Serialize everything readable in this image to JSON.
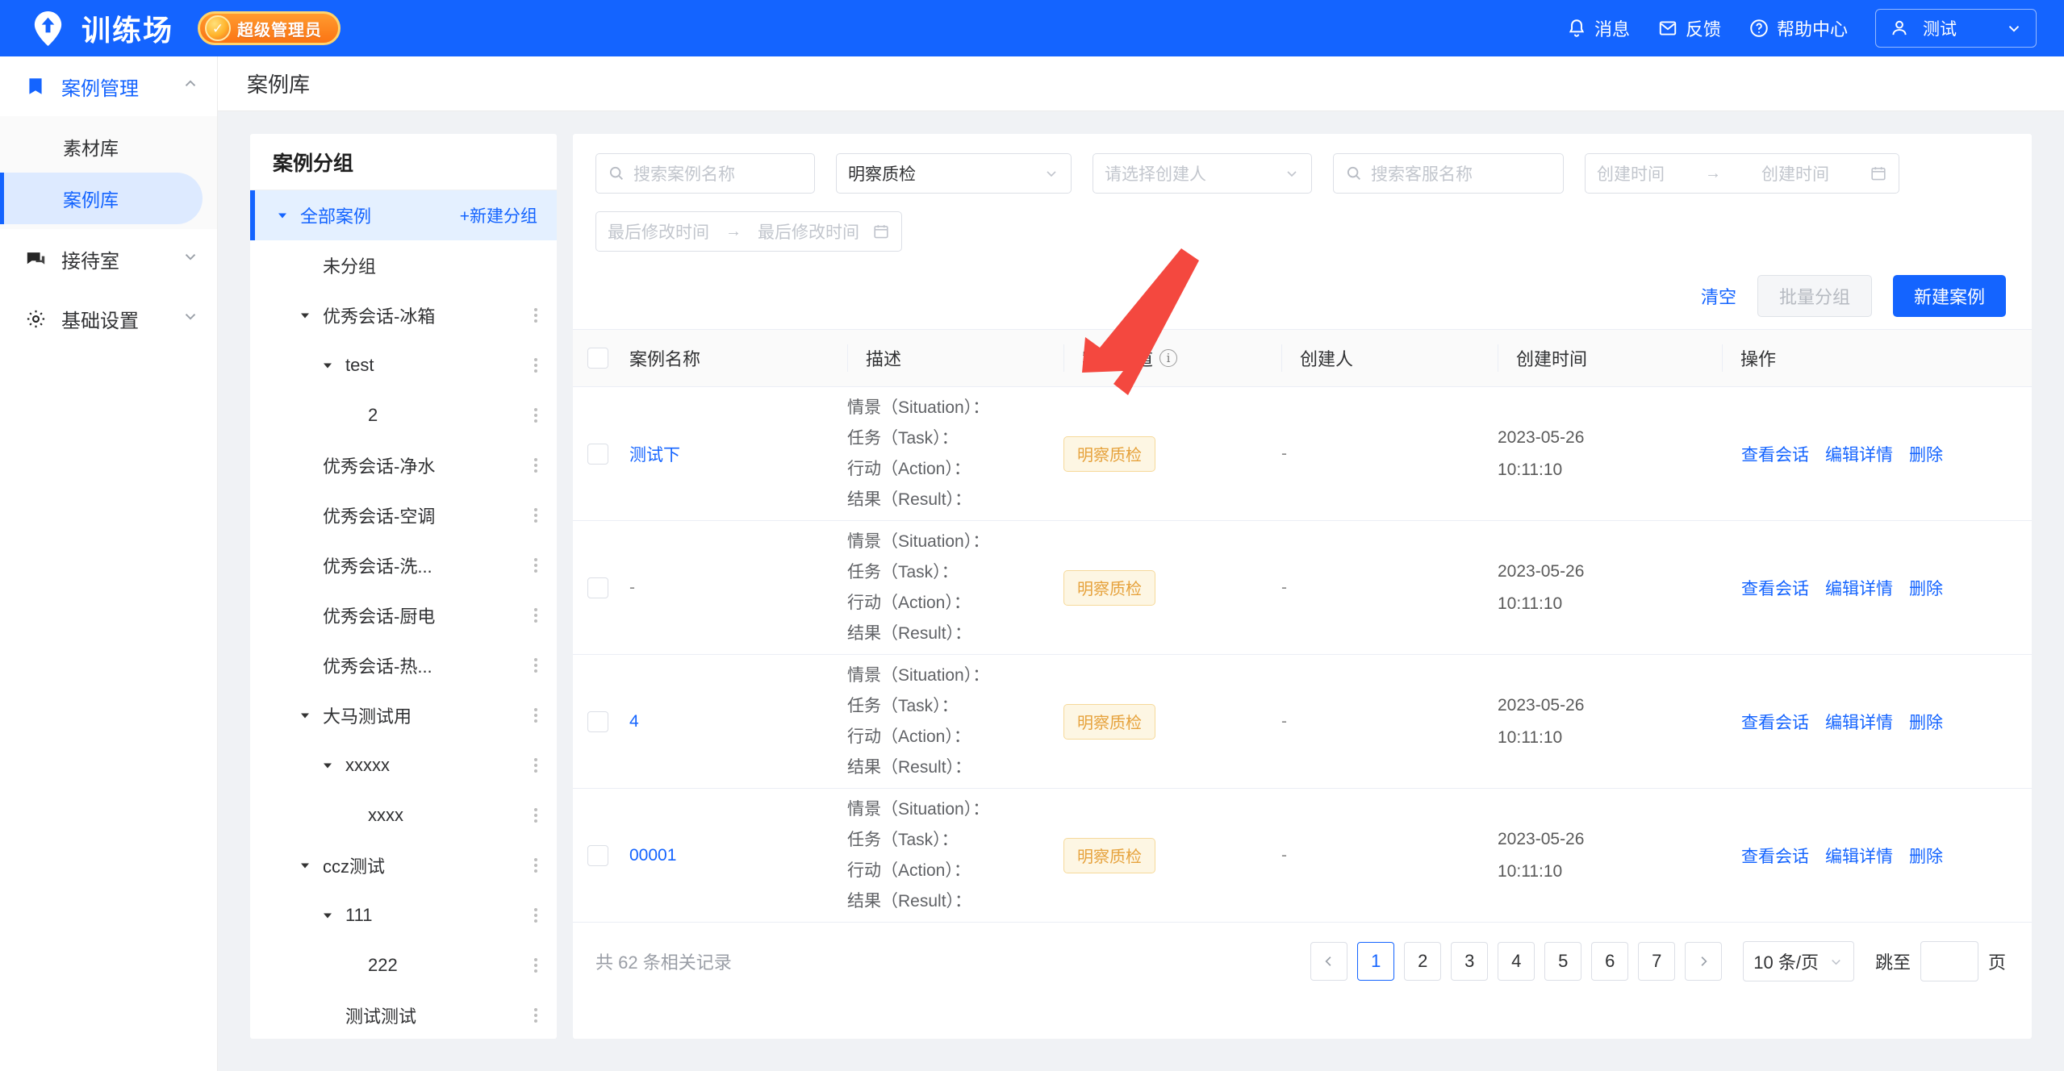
{
  "topbar": {
    "brand_name": "训练场",
    "admin_badge": "超级管理员",
    "items": [
      {
        "label": "消息",
        "icon": "bell-icon"
      },
      {
        "label": "反馈",
        "icon": "envelope-icon"
      },
      {
        "label": "帮助中心",
        "icon": "question-circle-icon"
      }
    ],
    "user": {
      "name": "测试",
      "icon": "user-icon",
      "caret": "chevron-down-icon"
    }
  },
  "sidebar": {
    "groups": [
      {
        "label": "案例管理",
        "icon": "book-icon",
        "expanded": true,
        "active": true,
        "children": [
          {
            "label": "素材库",
            "active": false
          },
          {
            "label": "案例库",
            "active": true
          }
        ]
      },
      {
        "label": "接待室",
        "icon": "chat-icon",
        "expanded": false,
        "active": false,
        "children": []
      },
      {
        "label": "基础设置",
        "icon": "gear-icon",
        "expanded": false,
        "active": false,
        "children": []
      }
    ],
    "collapse_icon": "collapse-panel-icon"
  },
  "page": {
    "title": "案例库"
  },
  "tree": {
    "title": "案例分组",
    "new_group_label": "+新建分组",
    "nodes": [
      {
        "label": "全部案例",
        "indent": 0,
        "caret": "down",
        "active": true,
        "more": false,
        "new_group": true
      },
      {
        "label": "未分组",
        "indent": 1,
        "caret": "none",
        "active": false,
        "more": false
      },
      {
        "label": "优秀会话-冰箱",
        "indent": 1,
        "caret": "down",
        "active": false,
        "more": true
      },
      {
        "label": "test",
        "indent": 2,
        "caret": "down",
        "active": false,
        "more": true
      },
      {
        "label": "2",
        "indent": 3,
        "caret": "none",
        "active": false,
        "more": true
      },
      {
        "label": "优秀会话-净水",
        "indent": 1,
        "caret": "none",
        "active": false,
        "more": true
      },
      {
        "label": "优秀会话-空调",
        "indent": 1,
        "caret": "none",
        "active": false,
        "more": true
      },
      {
        "label": "优秀会话-洗...",
        "indent": 1,
        "caret": "none",
        "active": false,
        "more": true
      },
      {
        "label": "优秀会话-厨电",
        "indent": 1,
        "caret": "none",
        "active": false,
        "more": true
      },
      {
        "label": "优秀会话-热...",
        "indent": 1,
        "caret": "none",
        "active": false,
        "more": true
      },
      {
        "label": "大马测试用",
        "indent": 1,
        "caret": "down",
        "active": false,
        "more": true
      },
      {
        "label": "xxxxx",
        "indent": 2,
        "caret": "down",
        "active": false,
        "more": true
      },
      {
        "label": "xxxx",
        "indent": 3,
        "caret": "none",
        "active": false,
        "more": true
      },
      {
        "label": "ccz测试",
        "indent": 1,
        "caret": "down",
        "active": false,
        "more": true
      },
      {
        "label": "111",
        "indent": 2,
        "caret": "down",
        "active": false,
        "more": true
      },
      {
        "label": "222",
        "indent": 3,
        "caret": "none",
        "active": false,
        "more": true
      },
      {
        "label": "测试测试",
        "indent": 2,
        "caret": "none",
        "active": false,
        "more": true
      }
    ]
  },
  "filters": {
    "case_name": {
      "placeholder": "搜索案例名称",
      "value": "",
      "icon": "search-icon"
    },
    "channel": {
      "value": "明察质检",
      "caret": "chevron-down-icon"
    },
    "creator": {
      "placeholder": "请选择创建人",
      "value": "",
      "caret": "chevron-down-icon"
    },
    "agent_name": {
      "placeholder": "搜索客服名称",
      "value": "",
      "icon": "search-icon"
    },
    "create_time": {
      "start_placeholder": "创建时间",
      "end_placeholder": "创建时间",
      "separator": "→",
      "icon": "calendar-icon"
    },
    "modify_time": {
      "start_placeholder": "最后修改时间",
      "end_placeholder": "最后修改时间",
      "separator": "→",
      "icon": "calendar-icon"
    }
  },
  "actions": {
    "clear": "清空",
    "batch_group": "批量分组",
    "new_case": "新建案例"
  },
  "table": {
    "headers": {
      "name": "案例名称",
      "desc": "描述",
      "channel": "案例渠道",
      "creator": "创建人",
      "create_time": "创建时间",
      "ops": "操作"
    },
    "channel_tooltip_icon": "info-icon",
    "desc_lines": [
      "情景（Situation）：",
      "任务（Task）：",
      "行动（Action）：",
      "结果（Result）："
    ],
    "ops_labels": {
      "view": "查看会话",
      "edit": "编辑详情",
      "delete": "删除"
    },
    "rows": [
      {
        "name": "测试下",
        "name_is_link": true,
        "channel": "明察质检",
        "creator": "-",
        "date": "2023-05-26",
        "time": "10:11:10"
      },
      {
        "name": "-",
        "name_is_link": false,
        "channel": "明察质检",
        "creator": "-",
        "date": "2023-05-26",
        "time": "10:11:10"
      },
      {
        "name": "4",
        "name_is_link": true,
        "channel": "明察质检",
        "creator": "-",
        "date": "2023-05-26",
        "time": "10:11:10"
      },
      {
        "name": "00001",
        "name_is_link": true,
        "channel": "明察质检",
        "creator": "-",
        "date": "2023-05-26",
        "time": "10:11:10"
      }
    ]
  },
  "pagination": {
    "total_text": "共 62 条相关记录",
    "prev_icon": "chevron-left-icon",
    "next_icon": "chevron-right-icon",
    "pages": [
      "1",
      "2",
      "3",
      "4",
      "5",
      "6",
      "7"
    ],
    "current_page": "1",
    "page_size": "10 条/页",
    "jump_label": "跳至",
    "jump_value": "",
    "jump_suffix": "页"
  },
  "annotation": {
    "arrow_color": "#f4483f"
  }
}
